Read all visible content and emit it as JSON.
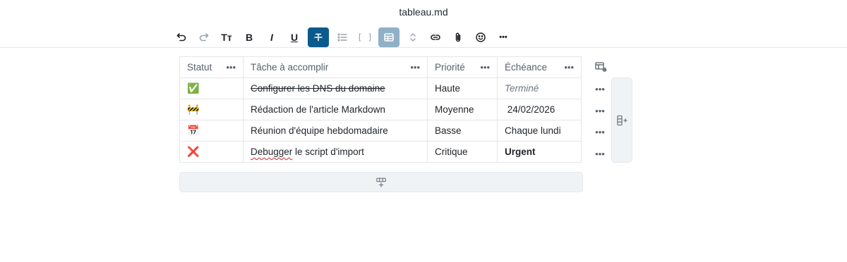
{
  "document": {
    "title": "tableau.md"
  },
  "toolbar": {
    "undo": "undo-icon",
    "redo": "redo-icon",
    "text_size_label": "Tт",
    "bold_label": "B",
    "italic_label": "I",
    "underline_label": "U",
    "strike": "strikethrough-icon",
    "list": "bullet-list-icon",
    "code_label": "[ ]",
    "table": "table-icon",
    "expand": "chevron-updown-icon",
    "link": "link-icon",
    "attach": "paperclip-icon",
    "emoji": "smiley-icon",
    "more_label": "•••"
  },
  "table": {
    "headers": [
      "Statut",
      "Tâche à accomplir",
      "Priorité",
      "Échéance"
    ],
    "header_menu_label": "•••",
    "rows": [
      {
        "status": "✅",
        "task": "Configurer les DNS du domaine",
        "priority": "Haute",
        "due": "Terminé"
      },
      {
        "status": "🚧",
        "task": "Rédaction de l'article Markdown",
        "priority": "Moyenne",
        "due": " 24/02/2026"
      },
      {
        "status": "📅",
        "task": "Réunion d'équipe hebdomadaire",
        "priority": "Basse",
        "due": "Chaque lundi"
      },
      {
        "status": "❌",
        "task_a": "Debugger",
        "task_b": " le script d'import",
        "priority": "Critique",
        "due": "Urgent"
      }
    ],
    "row_menu_label": "•••"
  },
  "colors": {
    "accent": "#0b5a8c",
    "accent_soft": "#8fb0c6",
    "panel": "#f0f3f6",
    "spellcheck": "#d1242f"
  }
}
